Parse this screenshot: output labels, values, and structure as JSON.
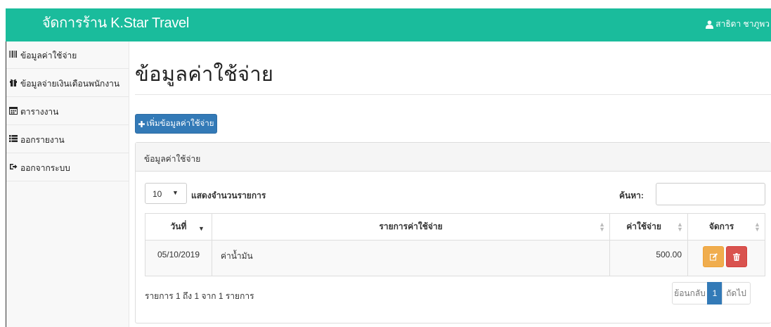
{
  "header": {
    "brand": "จัดการร้าน K.Star Travel",
    "user": "สาธิดา ชาภูพว"
  },
  "sidebar": {
    "items": [
      {
        "label": "ข้อมูลค่าใช้จ่าย",
        "icon": "barcode-icon"
      },
      {
        "label": "ข้อมูลจ่ายเงินเดือนพนักงาน",
        "icon": "gift-icon"
      },
      {
        "label": "ตารางงาน",
        "icon": "calendar-icon"
      },
      {
        "label": "ออกรายงาน",
        "icon": "list-icon"
      },
      {
        "label": "ออกจากระบบ",
        "icon": "logout-icon"
      }
    ]
  },
  "main": {
    "title": "ข้อมูลค่าใช้จ่าย",
    "add_button": "เพิ่มข้อมูลค่าใช้จ่าย",
    "panel_heading": "ข้อมูลค่าใช้จ่าย",
    "length_value": "10",
    "length_label": "แสดงจำนวนรายการ",
    "search_label": "ค้นหา:",
    "search_value": "",
    "columns": [
      "วันที่",
      "รายการค่าใช้จ่าย",
      "ค่าใช้จ่าย",
      "จัดการ"
    ],
    "rows": [
      {
        "date": "05/10/2019",
        "item": "ค่าน้ำมัน",
        "amount": "500.00"
      }
    ],
    "info": "รายการ 1 ถึง 1 จาก 1 รายการ",
    "pagination": {
      "prev": "ย้อนกลับ",
      "current": "1",
      "next": "ถัดไป"
    }
  },
  "colors": {
    "topbar": "#1abc9c",
    "primary": "#337ab7",
    "warning": "#f0ad4e",
    "danger": "#d9534f"
  }
}
